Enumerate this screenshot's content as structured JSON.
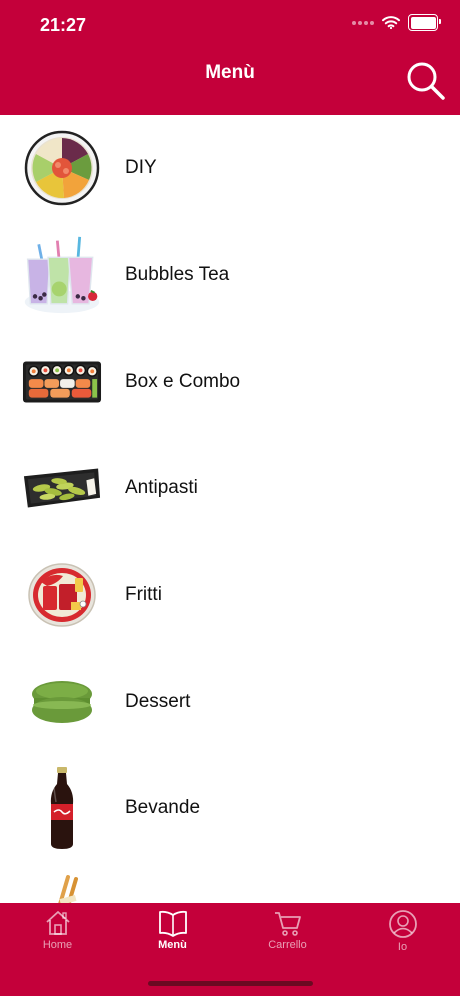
{
  "status_bar": {
    "time": "21:27"
  },
  "header": {
    "title": "Menù"
  },
  "menu": {
    "items": [
      {
        "label": "DIY",
        "icon": "poke-bowl-icon"
      },
      {
        "label": "Bubbles Tea",
        "icon": "bubble-tea-icon"
      },
      {
        "label": "Box e Combo",
        "icon": "sushi-box-icon"
      },
      {
        "label": "Antipasti",
        "icon": "edamame-icon"
      },
      {
        "label": "Fritti",
        "icon": "noodle-cup-icon"
      },
      {
        "label": "Dessert",
        "icon": "macaron-icon"
      },
      {
        "label": "Bevande",
        "icon": "cola-bottle-icon"
      },
      {
        "label": "",
        "icon": "chopsticks-icon"
      }
    ]
  },
  "tabbar": {
    "tabs": [
      {
        "label": "Home",
        "icon": "home-icon",
        "active": false
      },
      {
        "label": "Menù",
        "icon": "book-icon",
        "active": true
      },
      {
        "label": "Carrello",
        "icon": "cart-icon",
        "active": false
      },
      {
        "label": "Io",
        "icon": "user-icon",
        "active": false
      }
    ]
  },
  "colors": {
    "brand": "#c4003a",
    "text": "#111111",
    "background": "#ffffff"
  }
}
